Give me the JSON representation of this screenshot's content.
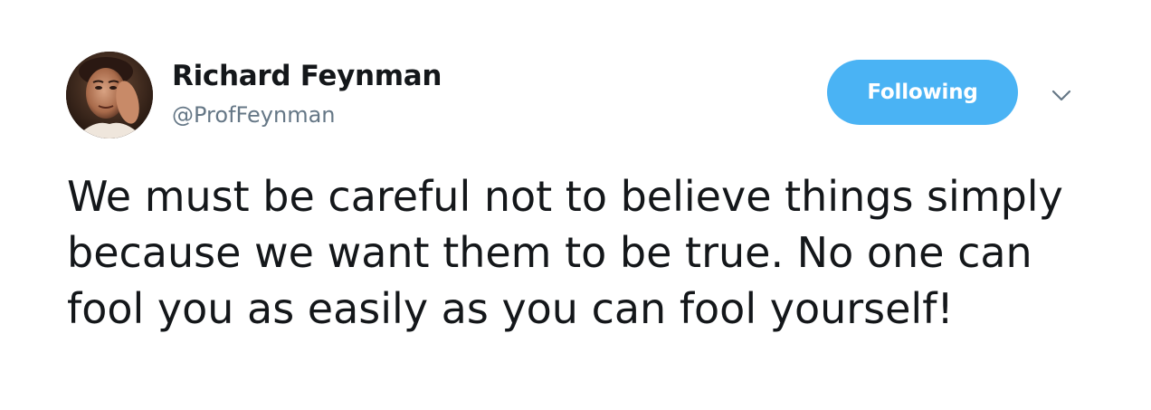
{
  "tweet": {
    "author": {
      "display_name": "Richard Feynman",
      "handle": "@ProfFeynman"
    },
    "follow_button_label": "Following",
    "text": "We must be careful not to believe things simply because we want them to be true. No one can fool you as easily as you can fool yourself!",
    "icons": {
      "menu": "chevron-down-icon"
    },
    "colors": {
      "accent": "#4ab3f4",
      "text": "#14171a",
      "secondary_text": "#657786"
    }
  }
}
